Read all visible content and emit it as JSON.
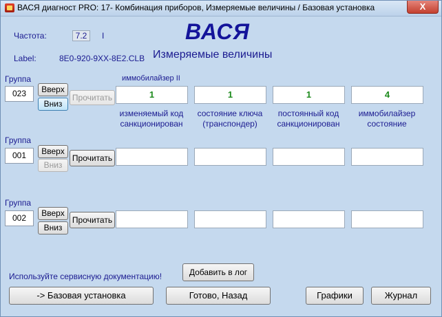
{
  "window": {
    "title": "ВАСЯ диагност PRO: 17- Комбинация приборов,  Измеряемые величины / Базовая установка",
    "close_glyph": "X"
  },
  "header": {
    "freq_label": "Частота:",
    "freq_value": "7.2",
    "freq_marker": "I",
    "app_name": "ВАСЯ",
    "label_label": "Label:",
    "label_value": "8E0-920-9XX-8E2.CLB",
    "heading": "Измеряемые величины"
  },
  "groups": [
    {
      "label": "Группа",
      "number": "023",
      "up_label": "Вверх",
      "down_label": "Вниз",
      "read_label": "Прочитать",
      "title": "иммобилайзер II",
      "fields": [
        {
          "value": "1",
          "desc": "изменяемый код санкционирован"
        },
        {
          "value": "1",
          "desc": "состояние ключа (транспондер)"
        },
        {
          "value": "1",
          "desc": "постоянный код санкционирован"
        },
        {
          "value": "4",
          "desc": "иммобилайзер состояние"
        }
      ]
    },
    {
      "label": "Группа",
      "number": "001",
      "up_label": "Вверх",
      "down_label": "Вниз",
      "read_label": "Прочитать",
      "fields": [
        {
          "value": ""
        },
        {
          "value": ""
        },
        {
          "value": ""
        },
        {
          "value": ""
        }
      ]
    },
    {
      "label": "Группа",
      "number": "002",
      "up_label": "Вверх",
      "down_label": "Вниз",
      "read_label": "Прочитать",
      "fields": [
        {
          "value": ""
        },
        {
          "value": ""
        },
        {
          "value": ""
        },
        {
          "value": ""
        }
      ]
    }
  ],
  "footer": {
    "hint": "Используйте сервисную документацию!",
    "add_log_label": "Добавить в лог",
    "basic_settings_label": "-> Базовая установка",
    "done_back_label": "Готово, Назад",
    "graphs_label": "Графики",
    "journal_label": "Журнал"
  },
  "colors": {
    "background": "#c4d9ee",
    "label_text": "#1a1a90",
    "value_text": "#1c8a1c"
  }
}
